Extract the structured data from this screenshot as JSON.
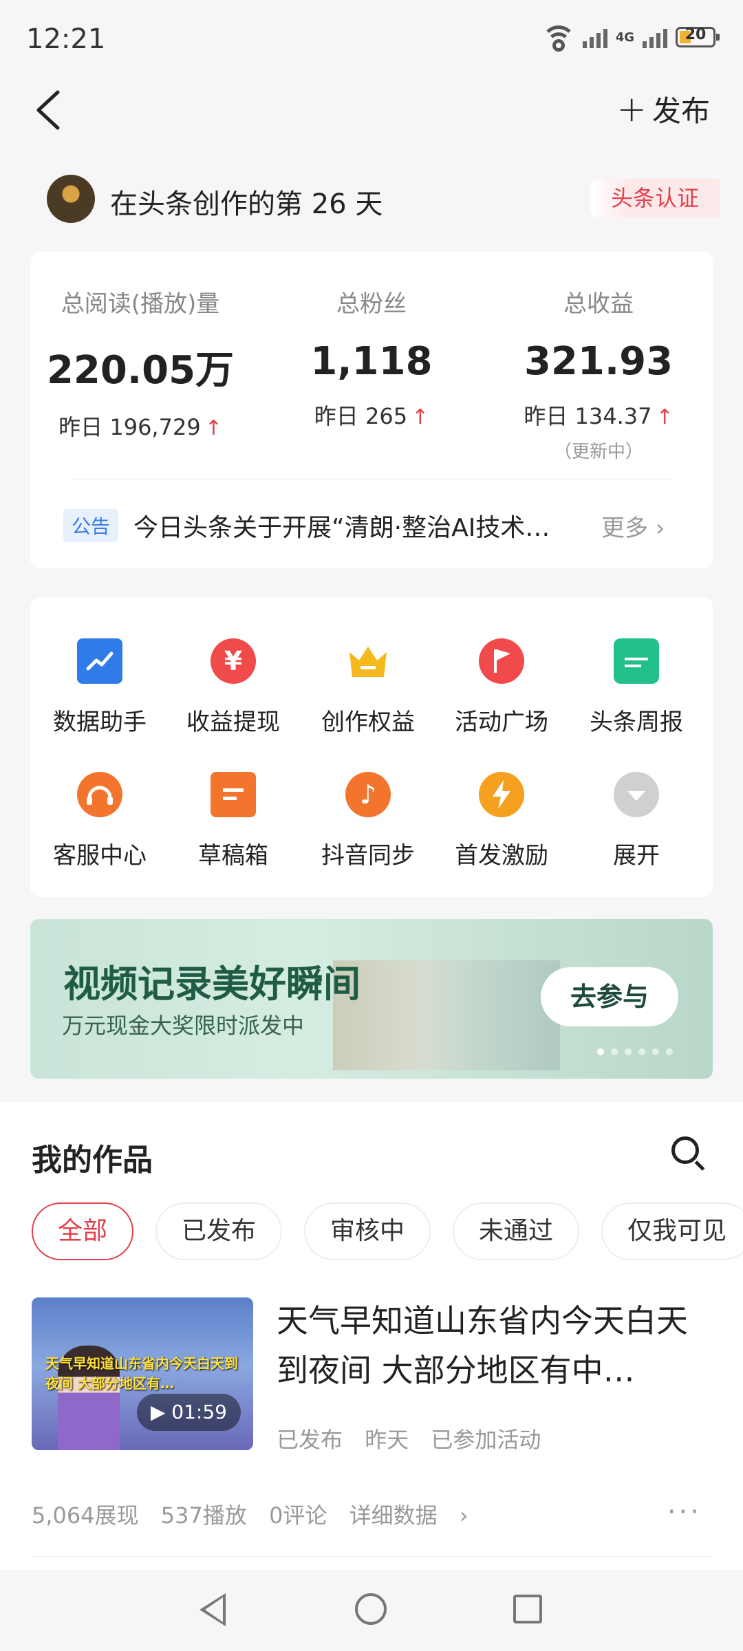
{
  "status_bar": {
    "time": "12:21",
    "network": "4G",
    "battery": "20"
  },
  "header": {
    "back_icon": "chevron-left-icon",
    "publish_label": "发布"
  },
  "creator": {
    "days_text": "在头条创作的第 26 天",
    "cert_label": "头条认证"
  },
  "stats": {
    "reads": {
      "label": "总阅读(播放)量",
      "value": "220.05万",
      "yesterday": "昨日 196,729"
    },
    "fans": {
      "label": "总粉丝",
      "value": "1,118",
      "yesterday": "昨日 265"
    },
    "income": {
      "label": "总收益",
      "value": "321.93",
      "yesterday": "昨日 134.37",
      "note": "（更新中）"
    },
    "up_arrow": "↑"
  },
  "notice": {
    "tag": "公告",
    "text": "今日头条关于开展“清朗·整治AI技术…",
    "more": "更多"
  },
  "tools": [
    {
      "label": "数据助手",
      "icon": "chart-icon",
      "color": "#2f7be8"
    },
    {
      "label": "收益提现",
      "icon": "yen-icon",
      "color": "#f04a4a"
    },
    {
      "label": "创作权益",
      "icon": "crown-icon",
      "color": "#f5b91e"
    },
    {
      "label": "活动广场",
      "icon": "flag-icon",
      "color": "#f04a4a"
    },
    {
      "label": "头条周报",
      "icon": "calendar-icon",
      "color": "#22c08a"
    },
    {
      "label": "客服中心",
      "icon": "headset-icon",
      "color": "#f3742c"
    },
    {
      "label": "草稿箱",
      "icon": "draft-icon",
      "color": "#f3742c"
    },
    {
      "label": "抖音同步",
      "icon": "douyin-icon",
      "color": "#f3742c"
    },
    {
      "label": "首发激励",
      "icon": "lightning-icon",
      "color": "#f5a01e"
    },
    {
      "label": "展开",
      "icon": "expand-icon",
      "color": "#d0d0d0"
    }
  ],
  "banner": {
    "title": "视频记录美好瞬间",
    "subtitle": "万元现金大奖限时派发中",
    "button": "去参与"
  },
  "works": {
    "title": "我的作品",
    "filters": [
      "全部",
      "已发布",
      "审核中",
      "未通过",
      "仅我可见"
    ],
    "item": {
      "title": "天气早知道山东省内今天白天到夜间 大部分地区有中…",
      "thumb_caption": "天气早知道山东省内今天白天到夜间 大部分地区有…",
      "duration": "01:59",
      "status": "已发布",
      "time": "昨天",
      "activity": "已参加活动",
      "impressions": "5,064展现",
      "plays": "537播放",
      "comments": "0评论",
      "details": "详细数据"
    }
  }
}
